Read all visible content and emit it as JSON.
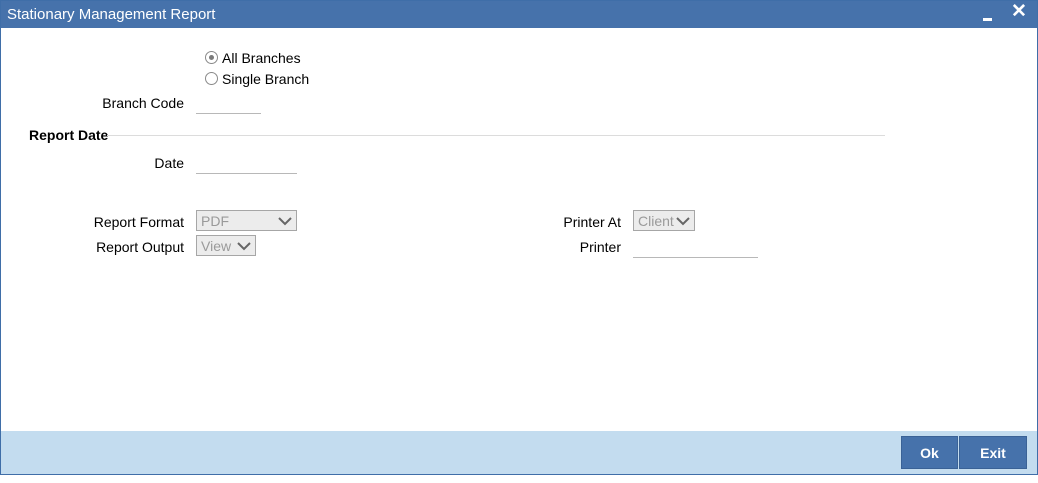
{
  "window": {
    "title": "Stationary Management Report",
    "minimize_icon": "minimize-icon",
    "close_icon": "close-icon",
    "close_glyph": "✕"
  },
  "branch": {
    "options": [
      {
        "label": "All Branches",
        "checked": true
      },
      {
        "label": "Single Branch",
        "checked": false
      }
    ],
    "branch_code_label": "Branch Code",
    "branch_code_value": ""
  },
  "report_date": {
    "section_title": "Report Date",
    "date_label": "Date",
    "date_value": ""
  },
  "report": {
    "format_label": "Report Format",
    "format_value": "PDF",
    "output_label": "Report Output",
    "output_value": "View",
    "printer_at_label": "Printer At",
    "printer_at_value": "Client",
    "printer_label": "Printer",
    "printer_value": ""
  },
  "footer": {
    "ok_label": "Ok",
    "exit_label": "Exit"
  },
  "colors": {
    "titlebar": "#4672ab",
    "footer": "#c3dcef",
    "button": "#4672ab"
  }
}
